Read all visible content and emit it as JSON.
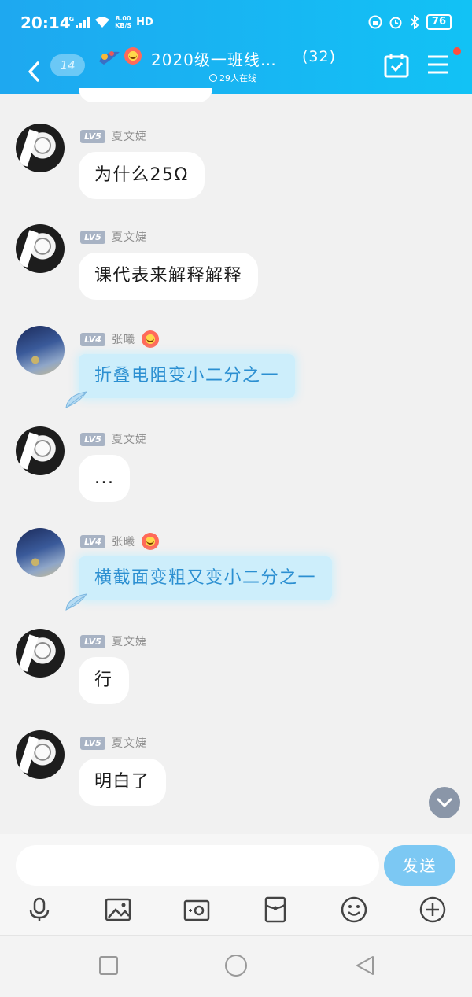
{
  "status_bar": {
    "time": "20:14",
    "network": "4G",
    "speed": "8.00\nKB/S",
    "hd": "HD",
    "battery": "76"
  },
  "header": {
    "unread_count": "14",
    "title": "2020级一班线…",
    "member_count": "(32)",
    "online": "29人在线"
  },
  "messages": [
    {
      "sender": "夏文婕",
      "level": "LV5",
      "text": "为什么25Ω",
      "avatar": "manga-avatar",
      "style": "white"
    },
    {
      "sender": "夏文婕",
      "level": "LV5",
      "text": "课代表来解释解释",
      "avatar": "manga-avatar",
      "style": "white"
    },
    {
      "sender": "张曦",
      "level": "LV4",
      "text": "折叠电阻变小二分之一",
      "avatar": "sky-avatar",
      "style": "blue"
    },
    {
      "sender": "夏文婕",
      "level": "LV5",
      "text": "...",
      "avatar": "manga-avatar",
      "style": "white"
    },
    {
      "sender": "张曦",
      "level": "LV4",
      "text": "横截面变粗又变小二分之一",
      "avatar": "sky-avatar",
      "style": "blue"
    },
    {
      "sender": "夏文婕",
      "level": "LV5",
      "text": "行",
      "avatar": "manga-avatar",
      "style": "white"
    },
    {
      "sender": "夏文婕",
      "level": "LV5",
      "text": "明白了",
      "avatar": "manga-avatar",
      "style": "white"
    }
  ],
  "input": {
    "placeholder": "",
    "send_label": "发送"
  },
  "toolbar_icons": [
    "microphone-icon",
    "image-icon",
    "camera-icon",
    "red-packet-icon",
    "emoji-icon",
    "plus-icon"
  ],
  "colors": {
    "header": "#1ea8f0",
    "send_button": "#7cc8f3",
    "level_badge": "#a8b3c4",
    "blue_bubble": "#cdeefb",
    "blue_text": "#2b8fd1"
  }
}
